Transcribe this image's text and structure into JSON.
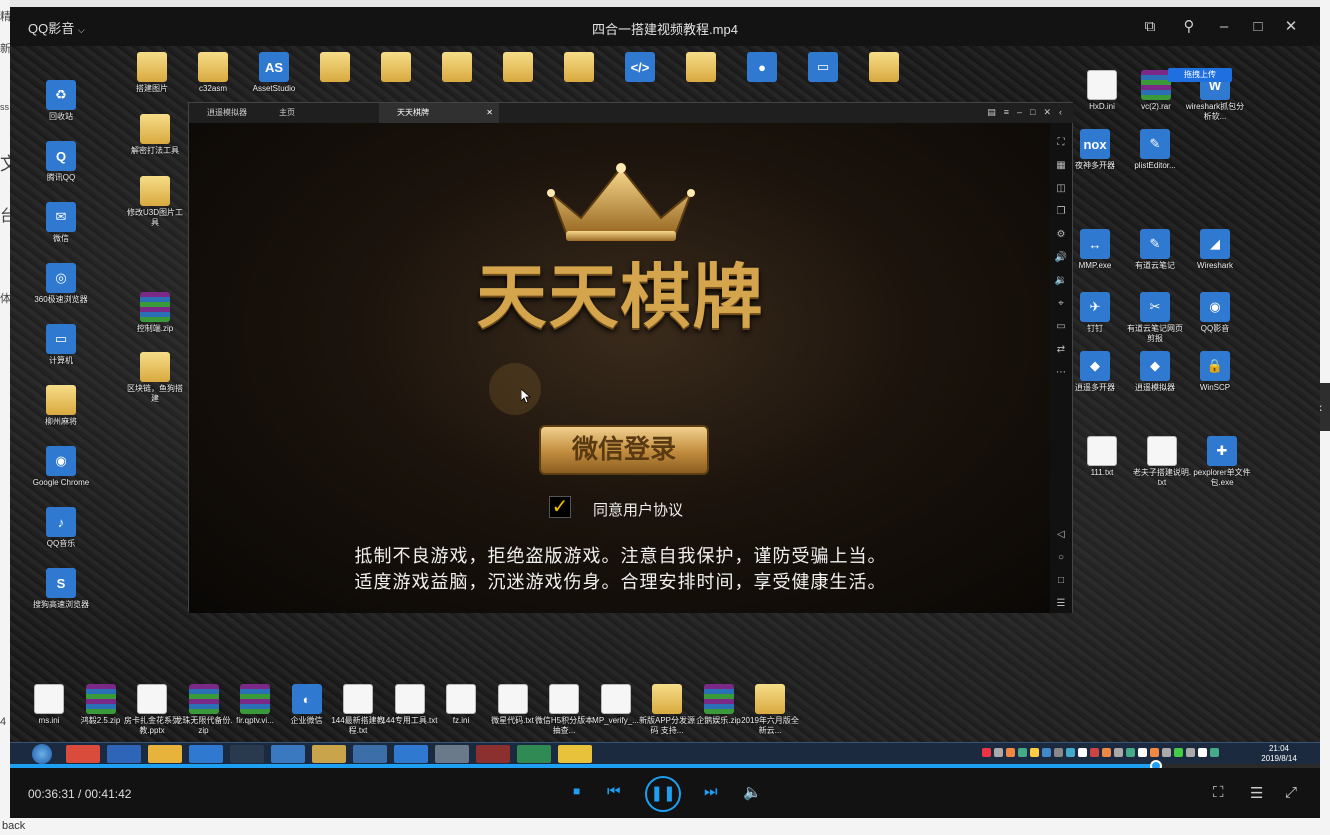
{
  "left_edge_fragments": [
    "精",
    "新",
    "ss",
    "文",
    "台",
    "体",
    "4"
  ],
  "bottom_fragment": "back",
  "player": {
    "app_name": "QQ影音",
    "title": "四合一搭建视频教程.mp4",
    "time_display": "00:36:31 / 00:41:42",
    "progress": 0.875
  },
  "desktop": {
    "top_row": [
      {
        "label": "搭建图片",
        "type": "folder"
      },
      {
        "label": "c32asm",
        "type": "folder"
      },
      {
        "label": "AssetStudio",
        "type": "app",
        "text": "AS"
      },
      {
        "label": "",
        "type": "folder"
      },
      {
        "label": "",
        "type": "folder"
      },
      {
        "label": "",
        "type": "folder"
      },
      {
        "label": "",
        "type": "folder"
      },
      {
        "label": "",
        "type": "folder"
      },
      {
        "label": "",
        "type": "app",
        "text": "</>"
      },
      {
        "label": "",
        "type": "folder"
      },
      {
        "label": "",
        "type": "app",
        "text": "●"
      },
      {
        "label": "",
        "type": "app",
        "text": "▭"
      },
      {
        "label": "",
        "type": "folder"
      }
    ],
    "col1": [
      {
        "label": "回收站",
        "type": "app",
        "text": "♻"
      },
      {
        "label": "腾讯QQ",
        "type": "app",
        "text": "Q"
      },
      {
        "label": "微信",
        "type": "app",
        "text": "✉"
      },
      {
        "label": "360极速浏览器",
        "type": "app",
        "text": "◎"
      },
      {
        "label": "计算机",
        "type": "app",
        "text": "▭"
      },
      {
        "label": "柳州麻将",
        "type": "folder"
      },
      {
        "label": "Google Chrome",
        "type": "app",
        "text": "◉"
      },
      {
        "label": "QQ音乐",
        "type": "app",
        "text": "♪"
      },
      {
        "label": "搜狗高速浏览器",
        "type": "app",
        "text": "S"
      }
    ],
    "col2": [
      {
        "label": "解密打法工具",
        "type": "folder"
      },
      {
        "label": "修改U3D图片工具",
        "type": "folder"
      },
      {
        "label": "控制端.zip",
        "type": "rar"
      },
      {
        "label": "区块链，鱼狗搭建",
        "type": "folder"
      }
    ],
    "right_icons": [
      {
        "label": "HxD.ini",
        "type": "file"
      },
      {
        "label": "vc(2).rar",
        "type": "rar"
      },
      {
        "label": "wireshark抓包分析软...",
        "type": "app",
        "text": "W"
      },
      {
        "label": "夜神多开器",
        "type": "app",
        "text": "nox"
      },
      {
        "label": "plistEditor...",
        "type": "app",
        "text": "✎"
      },
      {
        "label": "MMP.exe",
        "type": "app",
        "text": "↔"
      },
      {
        "label": "有道云笔记",
        "type": "app",
        "text": "✎"
      },
      {
        "label": "Wireshark",
        "type": "app",
        "text": "◢"
      },
      {
        "label": "钉钉",
        "type": "app",
        "text": "✈"
      },
      {
        "label": "有道云笔记网页剪报",
        "type": "app",
        "text": "✂"
      },
      {
        "label": "QQ影音",
        "type": "app",
        "text": "◉"
      },
      {
        "label": "逍遥多开器",
        "type": "app",
        "text": "◆"
      },
      {
        "label": "逍遥模拟器",
        "type": "app",
        "text": "◆"
      },
      {
        "label": "WinSCP",
        "type": "app",
        "text": "🔒"
      },
      {
        "label": "111.txt",
        "type": "file"
      },
      {
        "label": "老夫子搭建说明.txt",
        "type": "file"
      },
      {
        "label": "pexplorer单文件包.exe",
        "type": "app",
        "text": "✚"
      }
    ],
    "bottom_row": [
      {
        "label": "ms.ini",
        "type": "file"
      },
      {
        "label": "鸿毅2.5.zip",
        "type": "rar"
      },
      {
        "label": "房卡扎金花系列教.pptx",
        "type": "file"
      },
      {
        "label": "龙珠无限代备份.zip",
        "type": "rar"
      },
      {
        "label": "fir.qptv.vi...",
        "type": "rar"
      },
      {
        "label": "企业微信",
        "type": "app",
        "text": "◐"
      },
      {
        "label": "144最新搭建教程.txt",
        "type": "file"
      },
      {
        "label": "144专用工具.txt",
        "type": "file"
      },
      {
        "label": "fz.ini",
        "type": "file"
      },
      {
        "label": "微星代码.txt",
        "type": "file"
      },
      {
        "label": "微信H5积分版本抽查...",
        "type": "file"
      },
      {
        "label": "MP_verify_...",
        "type": "file"
      },
      {
        "label": "新版APP分发源码 支持...",
        "type": "folder"
      },
      {
        "label": "企鹅娱乐.zip",
        "type": "rar"
      },
      {
        "label": "2019年六月版全新云...",
        "type": "folder"
      }
    ],
    "upload_badge": "拖拽上传",
    "clock_time": "21:04",
    "clock_date": "2019/8/14"
  },
  "emulator": {
    "tabs": [
      "逍遥模拟器",
      "主页",
      "天天棋牌"
    ],
    "game_title": "天天棋牌",
    "login_button": "微信登录",
    "agree_text": "同意用户协议",
    "notice_line1": "抵制不良游戏，拒绝盗版游戏。注意自我保护，谨防受骗上当。",
    "notice_line2": "适度游戏益脑，沉迷游戏伤身。合理安排时间，享受健康生活。"
  },
  "colors": {
    "accent": "#1e9ff2",
    "gold": "#d4a54c",
    "checkbox": "#f0c000"
  }
}
